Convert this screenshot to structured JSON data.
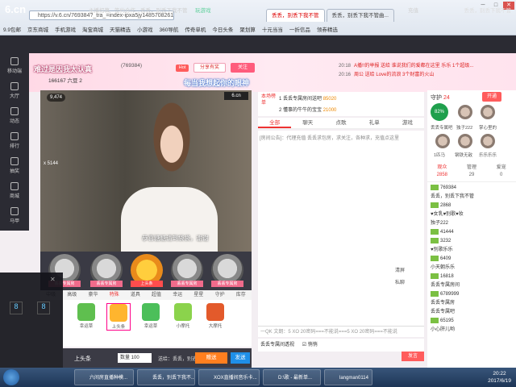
{
  "browser": {
    "address": "https://v.6.cn/769384?_tra_=index-ipxa5jy1485708261094",
    "tabs": [
      {
        "label": "丢丢，别丢下我不管"
      },
      {
        "label": "丢丢，别丢下我不管曲..."
      }
    ],
    "bookmarks": [
      "9.9包邮",
      "京东商城",
      "手机游戏",
      "淘宝商城",
      "天猫精选",
      "小游戏",
      "360导航",
      "传奇单机",
      "今日头条",
      "聚划算",
      "十元当当",
      "一折信品",
      "领券精选"
    ]
  },
  "site": {
    "logo": "6.cn",
    "logo_sub": "六间房",
    "links": [
      "主播招募",
      "签约合作",
      "丢丢，别丢下我不管",
      "玩游戏"
    ],
    "user": "丢丢，别丢下我不管",
    "search_label": "充值"
  },
  "leftnav": [
    "移动端",
    "大厅",
    "动态",
    "排行",
    "抽奖",
    "商城",
    "马甲"
  ],
  "room": {
    "anchor_title": "难过是因我太认真",
    "id_line": "(769384)",
    "stats": "166167 六豆 2",
    "slogan": "每当我想起你的眼神",
    "hot_badge": "Hot",
    "share_label": "分享有奖",
    "follow_label": "关注",
    "notices": [
      {
        "time": "20:18",
        "text": "A播!!的举报 送给 谁说我们的爱都在这里 乐乐 1个超级..."
      },
      {
        "time": "20:16",
        "text": "周公 送给 Love的流浪 3个财富的火山"
      }
    ]
  },
  "video": {
    "badge": "9,474",
    "logo": "6.cn",
    "caption": "恭喜糖糖请到袋袋，谢谢",
    "fans": "x 5144"
  },
  "gifts": {
    "top": [
      "丢丢专属房",
      "丢丢专属房",
      "上头条",
      "丢丢专属房",
      "丢丢专属房"
    ],
    "tabs": [
      "中级",
      "高级",
      "豪华",
      "特殊",
      "道具",
      "超值",
      "幸运",
      "星星",
      "守护",
      "库存"
    ],
    "items": [
      {
        "name": "幸运草"
      },
      {
        "name": "上头条"
      },
      {
        "name": "幸运草"
      },
      {
        "name": "小摩托"
      },
      {
        "name": "大摩托"
      }
    ],
    "send_label": "上头条",
    "qty": "数量 100",
    "send_to": "送给：丢丢，别逃",
    "gift_btn": "赠送",
    "send_btn": "发送"
  },
  "rank": {
    "title": "本场榜单",
    "rows": [
      {
        "rank": "1",
        "name": "丢丢专属房间送吧",
        "score": "85020"
      },
      {
        "rank": "2",
        "name": "懂事的牛牛的宝宝",
        "score": "21000"
      }
    ]
  },
  "chat": {
    "tabs": [
      "全部",
      "聊天",
      "点歌",
      "礼单",
      "游戏"
    ],
    "notice": "[房间公告]：代理充值 丢丢求包房，求关注，各种求，充值点这里",
    "input_placeholder": "一QK 文朗：5 XO 20密码===不能说===5 XO 20密码===不能说",
    "foot_target": "丢丢专属间透视",
    "foot_check": "悄悄",
    "speak_btn": "发言",
    "side": [
      "清屏",
      "私聊"
    ]
  },
  "right": {
    "guard_title": "守护",
    "guard_count": "24",
    "open_btn": "开通",
    "ring": "82%",
    "guards": [
      "丢丢专属吧",
      "独子222",
      "掌心里的",
      "1匹马",
      "钢铁无敌",
      "乐乐乐乐"
    ],
    "viewer_tabs": [
      {
        "label": "观众",
        "count": "2858"
      },
      {
        "label": "管理",
        "count": "29"
      },
      {
        "label": "爱宠",
        "count": "0"
      }
    ],
    "viewers": [
      "769384",
      "丢丢，别丢下我不管",
      "2868",
      "♥女乳♥别歌♥妆",
      "独子222",
      "41444",
      "3232",
      "♥别歌乐乐",
      "6409",
      "小天朝乐乐",
      "16818",
      "丢丢专属房间",
      "6789999",
      "丢丢专属房",
      "丢丢专属吧",
      "65195",
      "小心肝儿哟"
    ]
  },
  "taskbar": {
    "tasks": [
      "六间房直播种模...",
      "丢丢，别丢下我不...",
      "XOX直播间音乐卡...",
      "D:\\歌 - 最新单...",
      "langman0114"
    ],
    "time": "20:22",
    "date": "2017/6/19"
  }
}
